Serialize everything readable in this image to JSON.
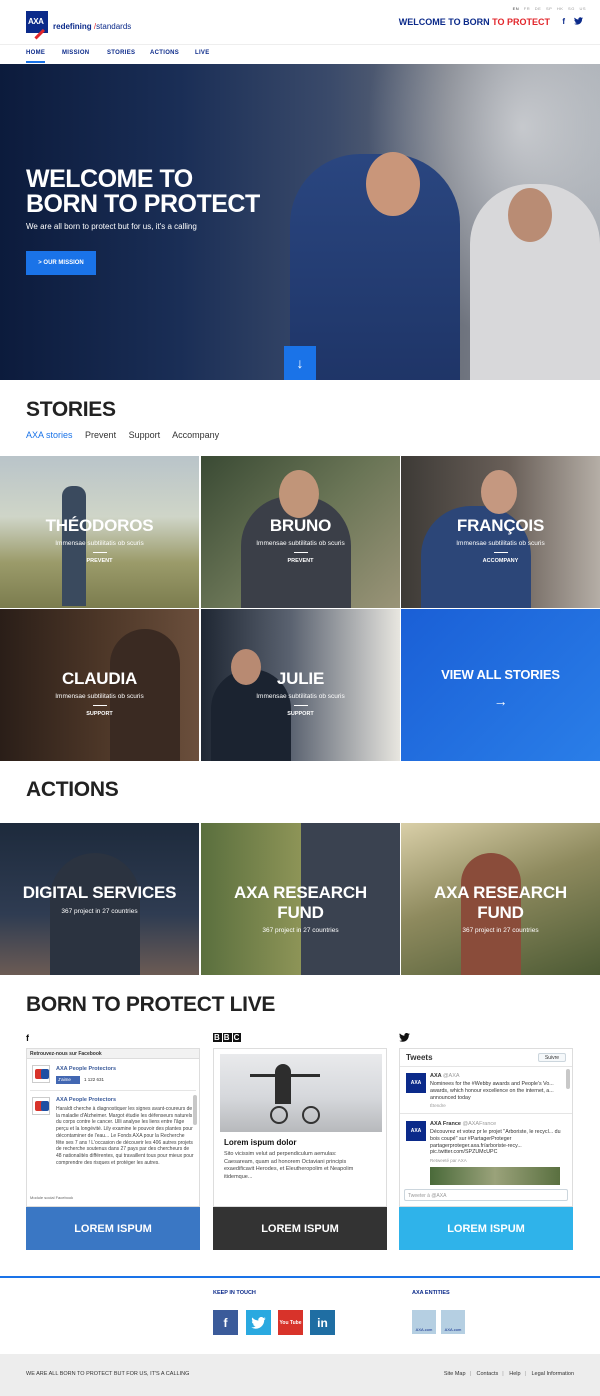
{
  "header": {
    "logo_text": "AXA",
    "tagline_bold": "redefining",
    "tagline_slash": "/",
    "tagline_rest": "standards",
    "languages": [
      "EN",
      "FR",
      "DE",
      "SP",
      "HK",
      "SG",
      "US"
    ],
    "title_blue": "WELCOME TO BORN",
    "title_red": "TO PROTECT",
    "facebook_icon": "f",
    "twitter_icon": "🐦"
  },
  "nav": {
    "items": [
      "HOME",
      "MISSION",
      "STORIES",
      "ACTIONS",
      "LIVE"
    ]
  },
  "hero": {
    "title_line1": "WELCOME TO",
    "title_line2": "BORN TO PROTECT",
    "subtitle": "We are all born to protect but for us, it's a calling",
    "button": "> OUR MISSION",
    "down_arrow": "↓"
  },
  "stories": {
    "title": "STORIES",
    "filters": [
      "AXA stories",
      "Prevent",
      "Support",
      "Accompany"
    ],
    "tiles": [
      {
        "name": "THÉODOROS",
        "desc": "Immensae subtilitatis ob scuris",
        "tag": "PREVENT"
      },
      {
        "name": "BRUNO",
        "desc": "Immensae subtilitatis ob scuris",
        "tag": "PREVENT"
      },
      {
        "name": "FRANÇOIS",
        "desc": "Immensae subtilitatis ob scuris",
        "tag": "ACCOMPANY"
      },
      {
        "name": "CLAUDIA",
        "desc": "Immensae subtilitatis ob scuris",
        "tag": "SUPPORT"
      },
      {
        "name": "JULIE",
        "desc": "Immensae subtilitatis ob scuris",
        "tag": "SUPPORT"
      }
    ],
    "view_all": "VIEW ALL STORIES",
    "view_all_arrow": "→"
  },
  "actions": {
    "title": "ACTIONS",
    "tiles": [
      {
        "name_line1": "DIGITAL SERVICES",
        "name_line2": "",
        "desc": "367 project in 27 countries"
      },
      {
        "name_line1": "AXA RESEARCH",
        "name_line2": "FUND",
        "desc": "367 project in 27 countries"
      },
      {
        "name_line1": "AXA RESEARCH",
        "name_line2": "FUND",
        "desc": "367 project in 27 countries"
      }
    ]
  },
  "live": {
    "title": "BORN TO PROTECT LIVE",
    "facebook": {
      "icon": "f",
      "header": "Retrouvez-nous sur Facebook",
      "page_name": "AXA People Protectors",
      "like": "J'aime",
      "count": "1 122 631",
      "post_name": "AXA People Protectors",
      "post_text": "Haraldt cherche à diagnostiquer les signes avant-coureurs de la maladie d'Alzheimer. Margot étudie les défenseurs naturels du corps contre le cancer. Ulli analyse les liens entre l'âge perçu et la longévité. Lily examine le pouvoir des plantes pour décontaminer de l'eau... Le Fonds AXA pour la Recherche fête ses 7 ans ! L'occasion de découvrir les 406 autres projets de recherche soutenus dans 27 pays par des chercheurs de 48 nationalités différentes, qui travaillent tous pour mieux pour comprendre des risques et protéger les autres.",
      "footer": "Module social Facebook",
      "button": "LOREM ISPUM",
      "color": "#3a77c4"
    },
    "bbc": {
      "icon": "BBC",
      "headline": "Lorem ispum dolor",
      "text": "Sito vicissim velut ad perpendiculum aemulas: Caesaream, quam ad honorem Octaviani principis exaedificavit Herodes, et Eleutheropolim et Neapolim itidemque...",
      "button": "LOREM ISPUM",
      "color": "#333333"
    },
    "twitter": {
      "icon": "🐦",
      "header": "Tweets",
      "follow": "Suivre",
      "tweet1_name": "AXA",
      "tweet1_handle": "@AXA",
      "tweet1_text": "Nominees for the #Webby awards and People's Vo... awards, which honour excellence on the internet, a... announced today",
      "tweet1_action": "Étendre",
      "tweet2_name": "AXA France",
      "tweet2_handle": "@AXAFrance",
      "tweet2_text": "Découvrez et votez pr le projet \"Arboriste, le recycl... du bois coupé\" sur #PartagerProteger partagerproteger.axa.fr/arboriste-recy... pic.twitter.com/SPZUMcUPC",
      "tweet2_retweet": "Retweeté par AXA",
      "input_placeholder": "Tweeter à @AXA",
      "button": "LOREM ISPUM",
      "color": "#2fb3ea"
    }
  },
  "footer": {
    "keep_in_touch": "KEEP IN TOUCH",
    "axa_entities": "AXA ENTITIES",
    "social": [
      {
        "label": "f",
        "color": "#3b5b9a"
      },
      {
        "label": "t",
        "color": "#2aa9e0"
      },
      {
        "label": "You Tube",
        "color": "#d8332a"
      },
      {
        "label": "in",
        "color": "#1f6ea3"
      }
    ],
    "entities": [
      "AXA.com",
      "AXA.com"
    ],
    "copyright": "WE ARE ALL BORN TO PROTECT BUT FOR US, IT'S A CALLING",
    "links": [
      "Site Map",
      "Contacts",
      "Help",
      "Legal Information"
    ]
  },
  "colors": {
    "brand_blue": "#0b2a8a",
    "accent": "#1a73e8",
    "red": "#e2262b"
  }
}
